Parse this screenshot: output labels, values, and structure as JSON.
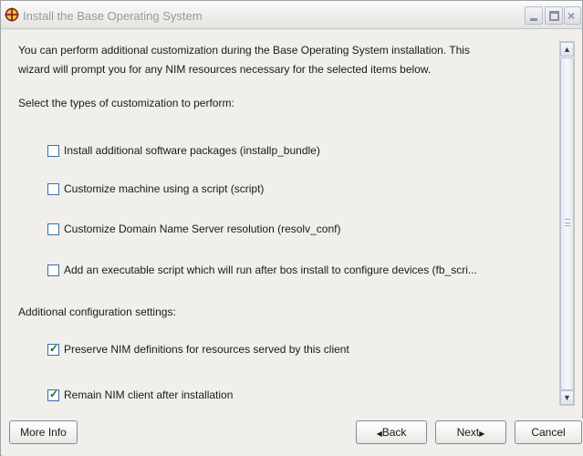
{
  "window": {
    "title": "Install the Base Operating System",
    "app_icon": "crosshair-target-icon",
    "controls": {
      "minimize": "_",
      "maximize": "□",
      "close": "×"
    }
  },
  "content": {
    "intro_line1": "You can perform additional customization during the Base Operating System installation.  This",
    "intro_line2": "wizard will prompt you for any NIM resources necessary for the selected items below.",
    "section_customization": "Select the types of customization to perform:",
    "customization_options": [
      {
        "label": "Install additional software packages (installp_bundle)",
        "checked": false
      },
      {
        "label": "Customize machine using a script (script)",
        "checked": false
      },
      {
        "label": "Customize Domain Name Server resolution (resolv_conf)",
        "checked": false
      },
      {
        "label": "Add an executable script which will run after bos install to configure devices (fb_scri...",
        "checked": false
      }
    ],
    "section_additional": "Additional configuration settings:",
    "additional_options": [
      {
        "label": "Preserve NIM definitions for resources served by this client",
        "checked": true
      },
      {
        "label": "Remain NIM client after installation",
        "checked": true
      }
    ],
    "check_glyph": "✓"
  },
  "scrollbar": {
    "up_glyph": "▲",
    "down_glyph": "▼"
  },
  "buttons": {
    "more_info": "More Info",
    "back": "Back",
    "back_arrow": "◀",
    "next": "Next",
    "next_arrow": "▶",
    "cancel": "Cancel"
  },
  "colors": {
    "panel_bg": "#f0efeb",
    "title_text": "#9a9a9a",
    "checkbox_border": "#3e6ea8",
    "checkmark": "#1b6a1b"
  }
}
